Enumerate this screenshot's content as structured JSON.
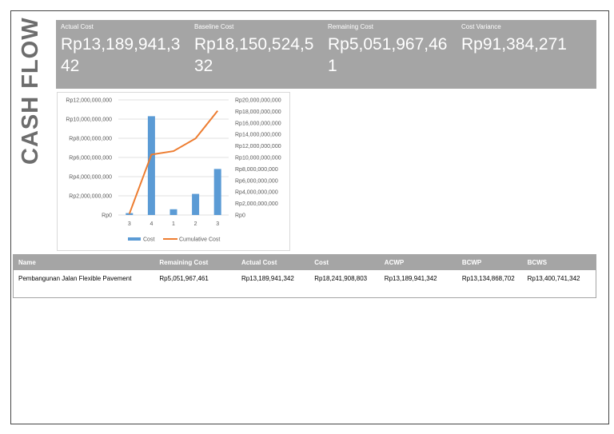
{
  "title": "CASH FLOW",
  "kpis": [
    {
      "label": "Actual Cost",
      "value": "Rp13,189,941,342"
    },
    {
      "label": "Baseline Cost",
      "value": "Rp18,150,524,532"
    },
    {
      "label": "Remaining Cost",
      "value": "Rp5,051,967,461"
    },
    {
      "label": "Cost Variance",
      "value": "Rp91,384,271"
    }
  ],
  "chart_data": {
    "type": "bar",
    "categories": [
      "3",
      "4",
      "1",
      "2",
      "3"
    ],
    "series": [
      {
        "name": "Cost",
        "type": "bar",
        "axis": "left",
        "color": "#5b9bd5",
        "values": [
          200000000,
          10300000000,
          600000000,
          2200000000,
          4800000000
        ]
      },
      {
        "name": "Cumulative Cost",
        "type": "line",
        "axis": "right",
        "color": "#ed7d31",
        "values": [
          200000000,
          10500000000,
          11100000000,
          13300000000,
          18100000000
        ]
      }
    ],
    "left_ticks": [
      "Rp0",
      "Rp2,000,000,000",
      "Rp4,000,000,000",
      "Rp6,000,000,000",
      "Rp8,000,000,000",
      "Rp10,000,000,000",
      "Rp12,000,000,000"
    ],
    "right_ticks": [
      "Rp0",
      "Rp2,000,000,000",
      "Rp4,000,000,000",
      "Rp6,000,000,000",
      "Rp8,000,000,000",
      "Rp10,000,000,000",
      "Rp12,000,000,000",
      "Rp14,000,000,000",
      "Rp16,000,000,000",
      "Rp18,000,000,000",
      "Rp20,000,000,000"
    ],
    "ylim": [
      0,
      12000000000
    ],
    "y2lim": [
      0,
      20000000000
    ],
    "legend": "bottom",
    "grid": true
  },
  "table": {
    "headers": [
      "Name",
      "Remaining Cost",
      "Actual Cost",
      "Cost",
      "ACWP",
      "BCWP",
      "BCWS"
    ],
    "rows": [
      [
        "Pembangunan Jalan Flexible Pavement",
        "Rp5,051,967,461",
        "Rp13,189,941,342",
        "Rp18,241,908,803",
        "Rp13,189,941,342",
        "Rp13,134,868,702",
        "Rp13,400,741,342"
      ]
    ]
  }
}
